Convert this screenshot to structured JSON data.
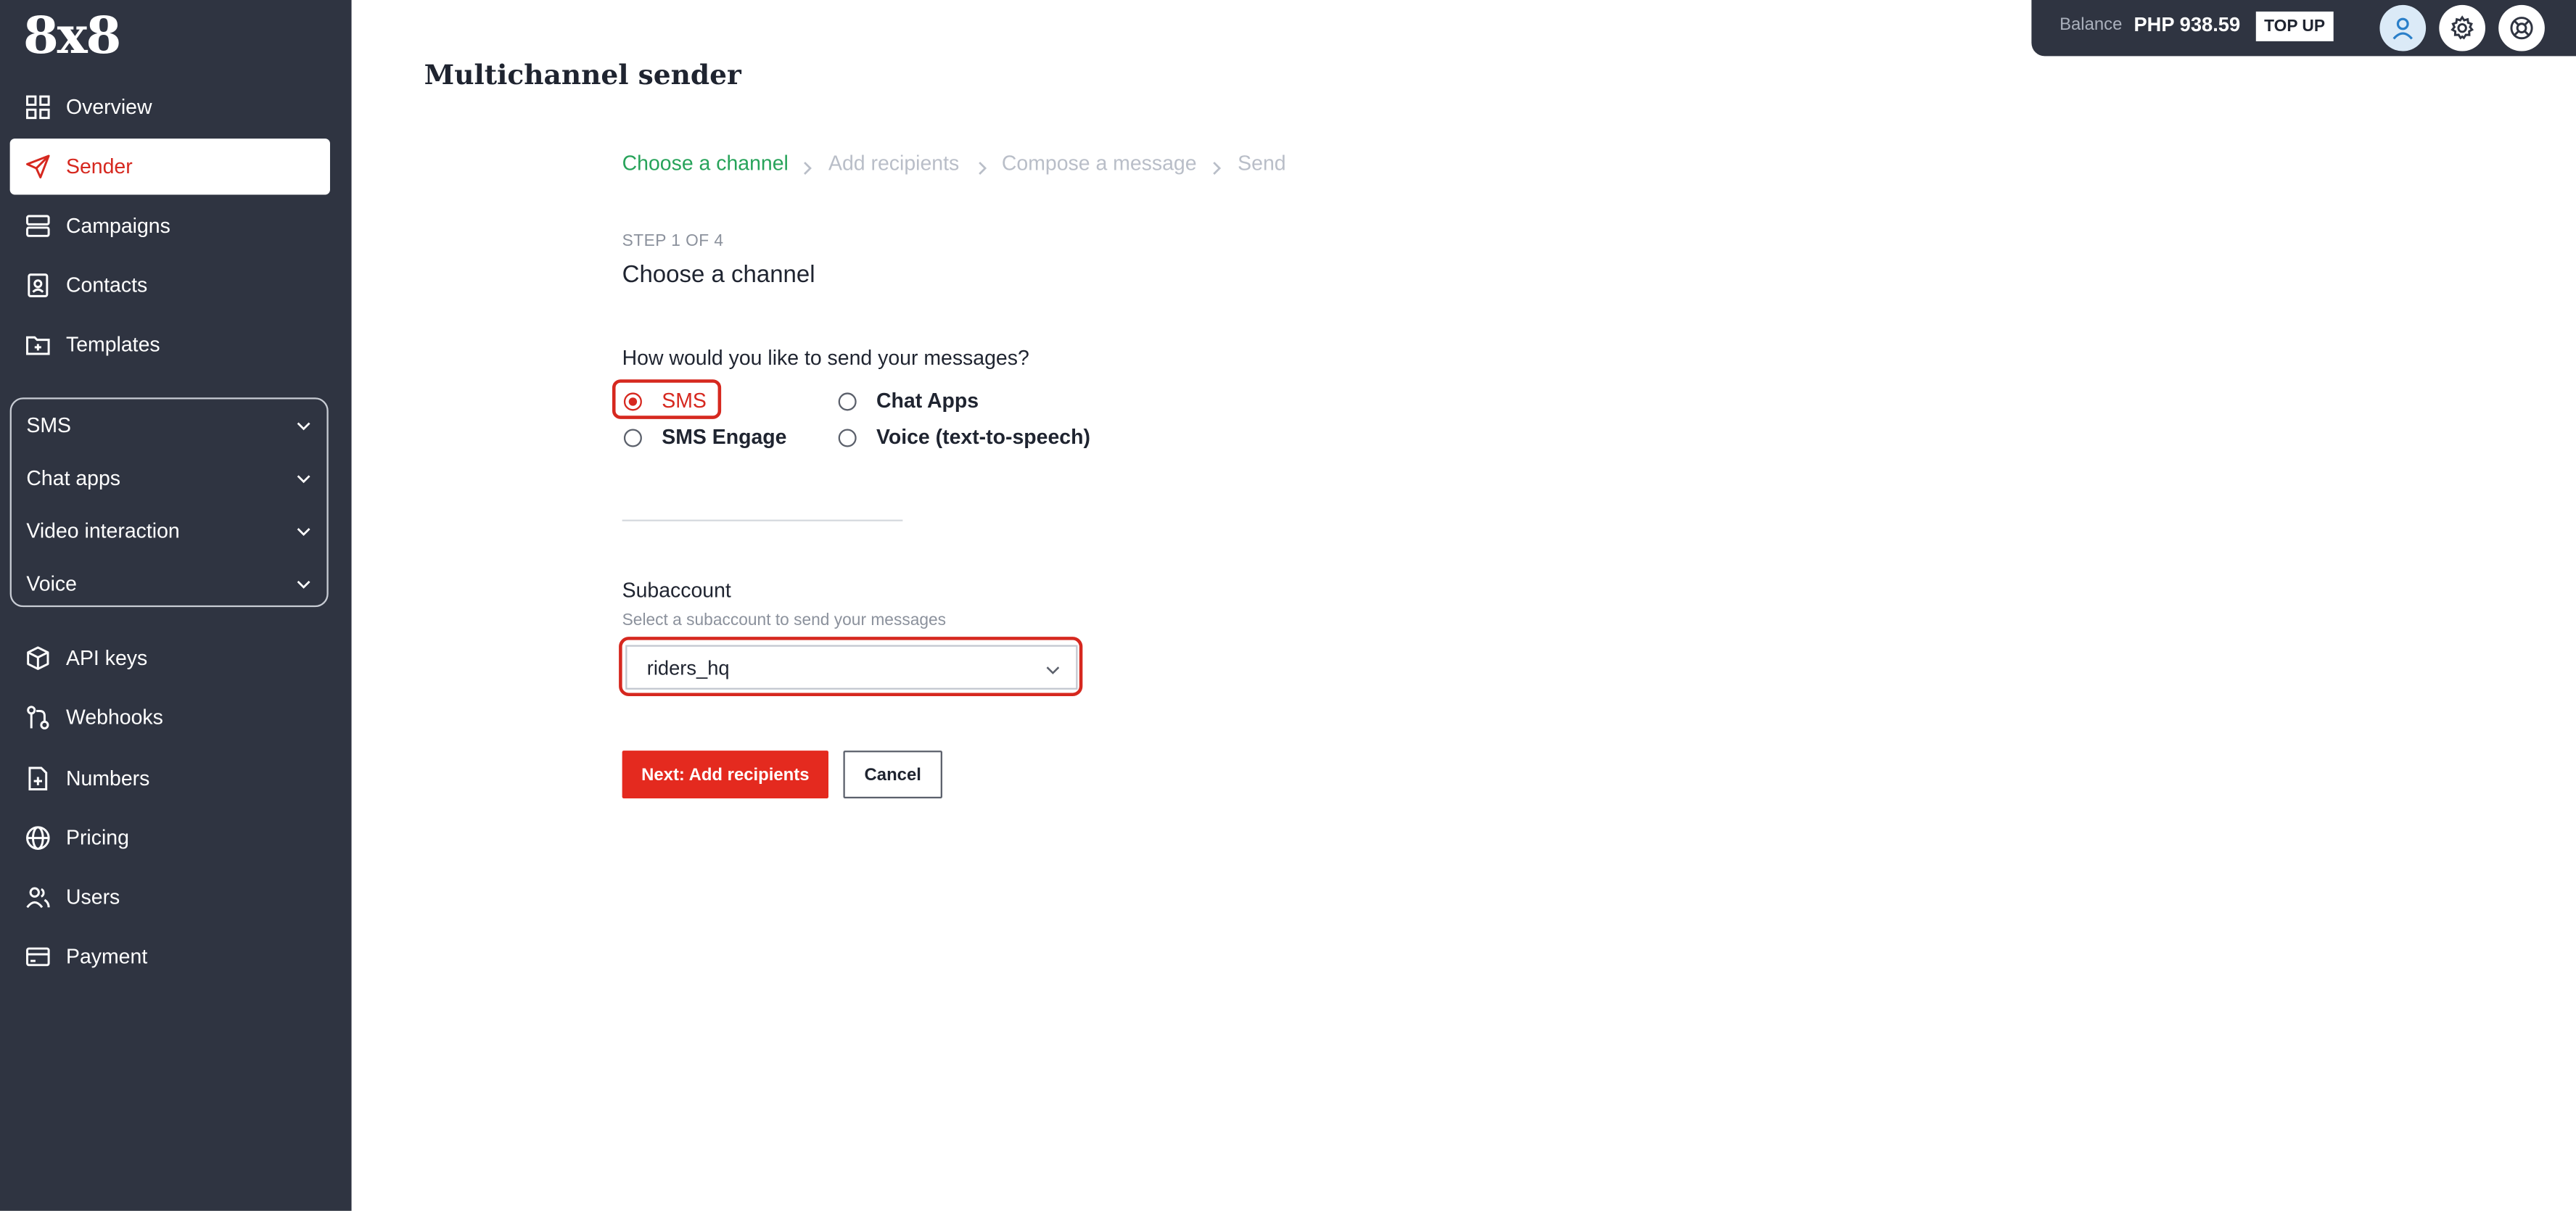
{
  "app": {
    "logo": "8x8"
  },
  "sidebar": {
    "items": [
      {
        "label": "Overview",
        "icon": "grid-icon"
      },
      {
        "label": "Sender",
        "icon": "send-icon",
        "active": true
      },
      {
        "label": "Campaigns",
        "icon": "campaigns-icon"
      },
      {
        "label": "Contacts",
        "icon": "contacts-icon"
      },
      {
        "label": "Templates",
        "icon": "templates-icon"
      }
    ],
    "groups": [
      {
        "label": "SMS"
      },
      {
        "label": "Chat apps"
      },
      {
        "label": "Video interaction"
      },
      {
        "label": "Voice"
      }
    ],
    "bottom_items": [
      {
        "label": "API keys",
        "icon": "cube-icon"
      },
      {
        "label": "Webhooks",
        "icon": "webhook-icon"
      },
      {
        "label": "Numbers",
        "icon": "numbers-icon"
      },
      {
        "label": "Pricing",
        "icon": "globe-icon"
      },
      {
        "label": "Users",
        "icon": "users-icon"
      },
      {
        "label": "Payment",
        "icon": "card-icon"
      }
    ]
  },
  "topbar": {
    "balance_label": "Balance",
    "balance_value": "PHP 938.59",
    "topup_label": "TOP UP"
  },
  "page": {
    "title": "Multichannel sender"
  },
  "breadcrumb": {
    "steps": [
      "Choose a channel",
      "Add recipients",
      "Compose a message",
      "Send"
    ]
  },
  "step": {
    "label": "STEP 1 OF 4",
    "title": "Choose a channel",
    "question": "How would you like to send your messages?",
    "options": [
      {
        "label": "SMS",
        "selected": true
      },
      {
        "label": "Chat Apps",
        "selected": false
      },
      {
        "label": "SMS Engage",
        "selected": false
      },
      {
        "label": "Voice (text-to-speech)",
        "selected": false
      }
    ]
  },
  "subaccount": {
    "label": "Subaccount",
    "help": "Select a subaccount to send your messages",
    "value": "riders_hq"
  },
  "actions": {
    "next_label": "Next: Add recipients",
    "cancel_label": "Cancel"
  },
  "colors": {
    "sidebar_bg": "#2f3441",
    "accent_red": "#e42a1f",
    "active_step_green": "#27a35a",
    "inactive_step": "#b9bec8"
  }
}
